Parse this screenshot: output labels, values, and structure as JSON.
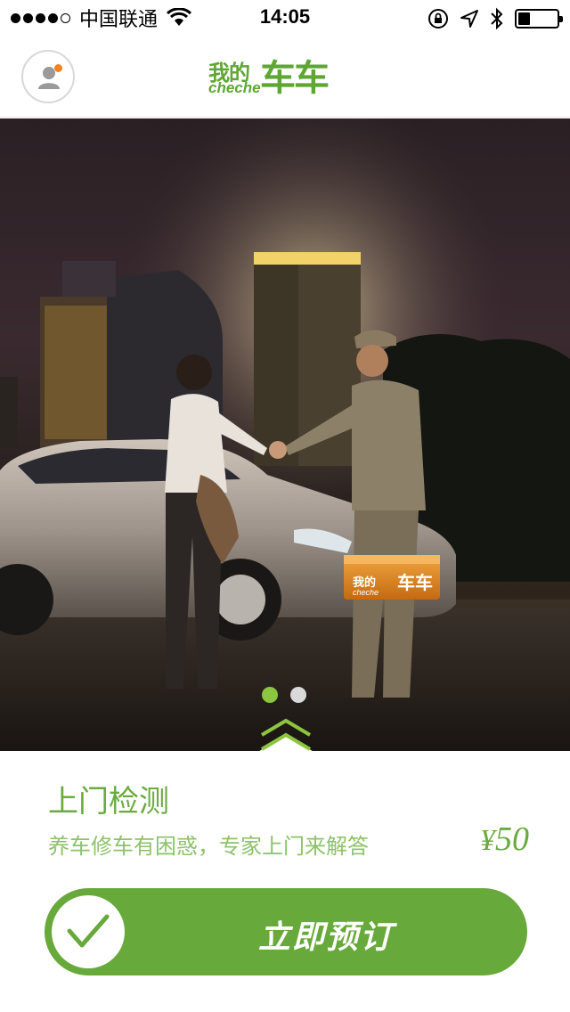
{
  "status_bar": {
    "carrier": "中国联通",
    "time": "14:05",
    "battery_level": 0.32
  },
  "header": {
    "logo_cn_small": "我的",
    "logo_en": "cheche",
    "logo_cn_big": "车车",
    "notification_color": "#f5821f"
  },
  "banner": {
    "box_logo_small": "我的",
    "box_logo_big": "车车",
    "box_logo_en": "cheche",
    "pages_total": 2,
    "current_page": 1
  },
  "service": {
    "title": "上门检测",
    "description": "养车修车有困惑，专家上门来解答",
    "price_symbol": "¥",
    "price_value": "50"
  },
  "action": {
    "book_label": "立即预订"
  },
  "colors": {
    "brand_green": "#67a93b",
    "light_green": "#8cc26a",
    "pager_active": "#8cc63f"
  }
}
